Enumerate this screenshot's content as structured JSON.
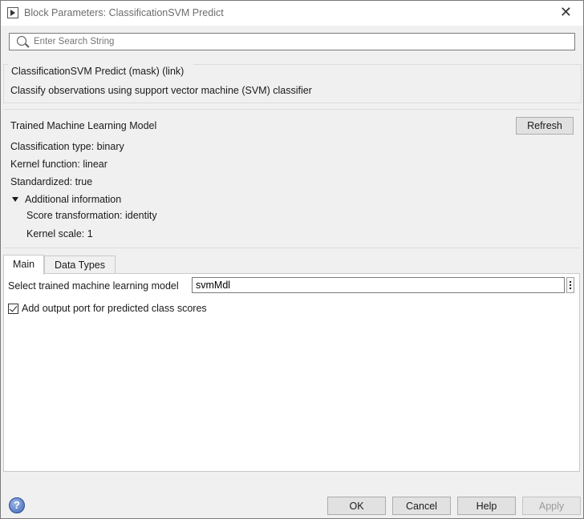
{
  "window": {
    "title": "Block Parameters: ClassificationSVM Predict",
    "close_glyph": "✕"
  },
  "search": {
    "placeholder": "Enter Search String",
    "value": ""
  },
  "description": {
    "title": "ClassificationSVM Predict (mask) (link)",
    "text": "Classify observations using support vector machine (SVM) classifier"
  },
  "model_info": {
    "heading": "Trained Machine Learning Model",
    "refresh_label": "Refresh",
    "classification_type": "Classification type: binary",
    "kernel_function": "Kernel function: linear",
    "standardized": "Standardized: true",
    "additional_label": "Additional information",
    "score_transformation": "Score transformation: identity",
    "kernel_scale": "Kernel scale: 1"
  },
  "tabs": [
    {
      "label": "Main",
      "active": true
    },
    {
      "label": "Data Types",
      "active": false
    }
  ],
  "main_tab": {
    "model_label": "Select trained machine learning model",
    "model_value": "svmMdl",
    "scores_checkbox_label": "Add output port for predicted class scores",
    "scores_checked": true
  },
  "buttons": {
    "ok": "OK",
    "cancel": "Cancel",
    "help": "Help",
    "apply": "Apply"
  },
  "help_icon_glyph": "?",
  "icons": [
    "app-icon",
    "close-icon",
    "search-icon",
    "triangle-down-icon",
    "ellipsis-vertical-icon",
    "help-icon"
  ]
}
